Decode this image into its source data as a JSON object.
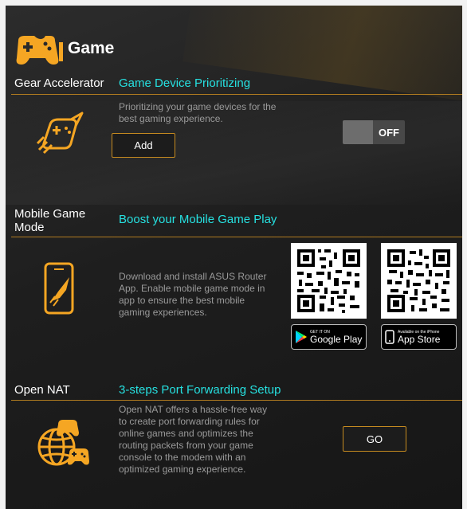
{
  "header": {
    "title": "Game",
    "icon": "gamepad-icon"
  },
  "sections": {
    "gear": {
      "label": "Gear Accelerator",
      "title": "Game Device Prioritizing",
      "desc_lines": [
        "Prioritizing your game devices for the",
        "best gaming experience."
      ],
      "button_label": "Add",
      "toggle_state": "OFF",
      "icon": "rocket-gamepad-icon"
    },
    "mobile": {
      "label_lines": [
        "Mobile Game",
        "Mode"
      ],
      "title": "Boost your Mobile Game Play",
      "desc_lines": [
        "Download and install ASUS Router",
        "App. Enable mobile game mode in",
        "app to ensure the best mobile",
        "gaming experiences."
      ],
      "icon": "phone-rocket-icon",
      "google_play": {
        "small": "GET IT ON",
        "big": "Google Play"
      },
      "app_store": {
        "small": "Available on the iPhone",
        "big": "App Store"
      }
    },
    "nat": {
      "label": "Open NAT",
      "title": "3-steps Port Forwarding Setup",
      "desc_lines": [
        "Open NAT offers a hassle-free way",
        "to create port forwarding rules for",
        "online games and optimizes the",
        "routing packets from your game",
        "console to the modem with an",
        "optimized gaming experience."
      ],
      "button_label": "GO",
      "icon": "globe-gamepad-icon"
    }
  },
  "colors": {
    "accent": "#f5a623",
    "title": "#26e0e0",
    "rule": "#b07b20"
  }
}
